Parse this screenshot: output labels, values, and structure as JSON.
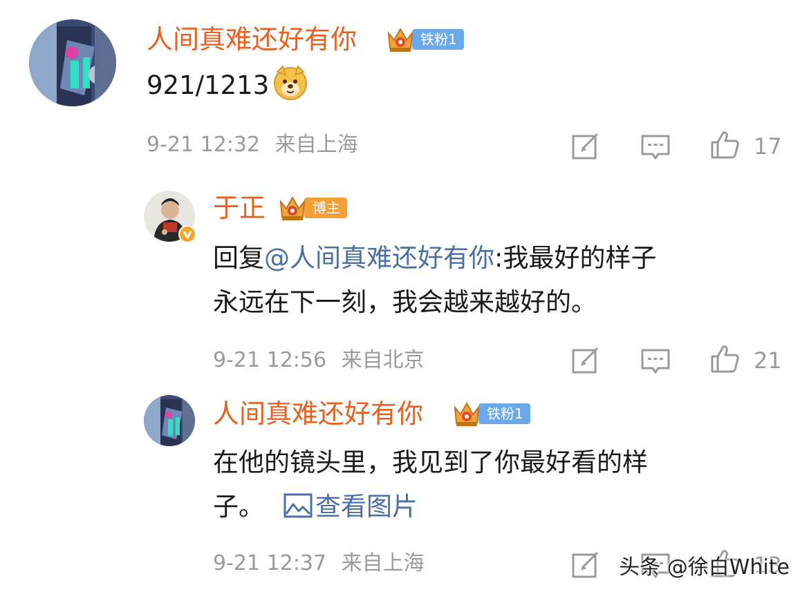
{
  "comments": [
    {
      "username": "人间真难还好有你",
      "badge": "铁粉1",
      "content": "921/1213",
      "emoji": "doge-emoji",
      "time": "9-21 12:32",
      "location": "来自上海",
      "likes": "17"
    },
    {
      "username": "于正",
      "badge": "博主",
      "verified": true,
      "content_prefix": "回复",
      "mention": "@人间真难还好有你",
      "content_line1": ":我最好的样子",
      "content_line2": "永远在下一刻，我会越来越好的。",
      "time": "9-21 12:56",
      "location": "来自北京",
      "likes": "21"
    },
    {
      "username": "人间真难还好有你",
      "badge": "铁粉1",
      "content_line1": "在他的镜头里，我见到了你最好看的样",
      "content_line2": "子。",
      "view_image": "查看图片",
      "time": "9-21 12:37",
      "location": "来自上海",
      "likes": "13"
    }
  ],
  "watermark": "头条 @徐白White",
  "colors": {
    "username": "#e8601f",
    "mention": "#4a6fa5",
    "fan_badge": "#6aa9e9",
    "host_badge": "#f2a03a",
    "meta": "#9a9a9a"
  }
}
